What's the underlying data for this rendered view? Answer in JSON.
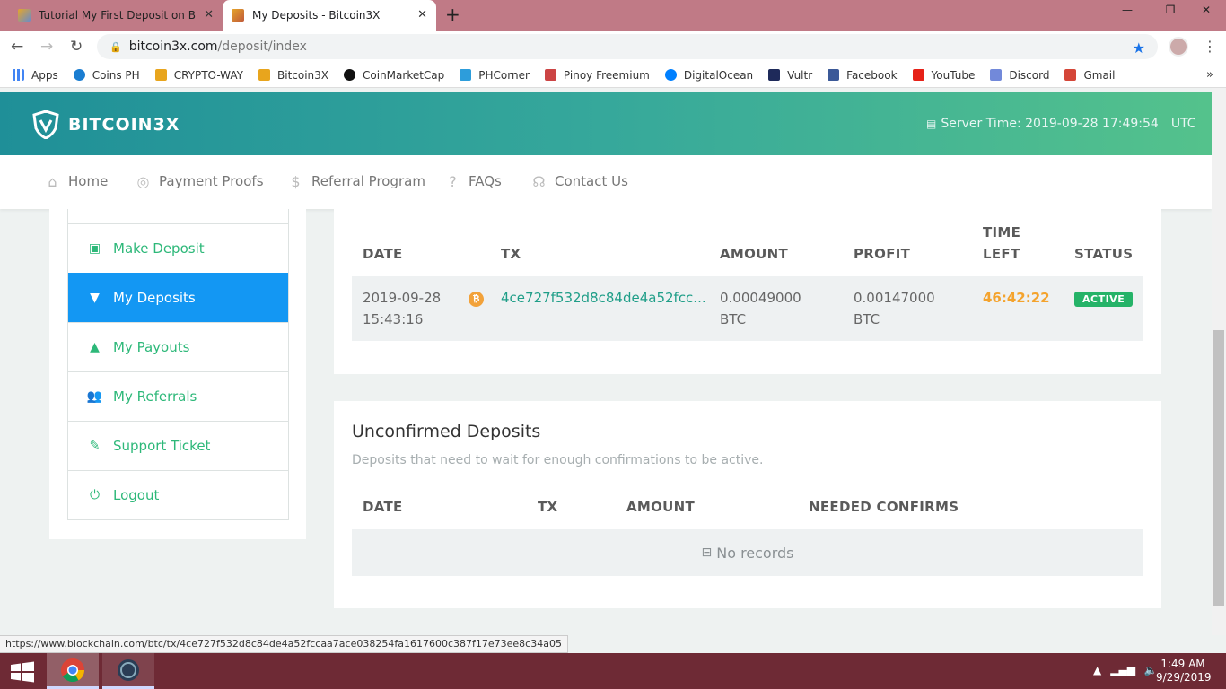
{
  "browser": {
    "tabs": [
      {
        "title": "Tutorial My First Deposit on Bitco",
        "active": false
      },
      {
        "title": "My Deposits - Bitcoin3X",
        "active": true
      }
    ],
    "new_tab_icon": "plus-icon",
    "url_host": "bitcoin3x.com",
    "url_path": "/deposit/index",
    "bookmarks": [
      {
        "label": "Apps",
        "icon": "apps-grid-icon",
        "color": "#4285f4"
      },
      {
        "label": "Coins PH",
        "icon": "coins-ph-icon",
        "color": "#1a7dd1"
      },
      {
        "label": "CRYPTO-WAY",
        "icon": "shield-icon",
        "color": "#e8a51d"
      },
      {
        "label": "Bitcoin3X",
        "icon": "shield-icon",
        "color": "#e8a51d"
      },
      {
        "label": "CoinMarketCap",
        "icon": "coinmarketcap-icon",
        "color": "#111111"
      },
      {
        "label": "PHCorner",
        "icon": "cube-icon",
        "color": "#2d9ddb"
      },
      {
        "label": "Pinoy Freemium",
        "icon": "flag-icon",
        "color": "#c44"
      },
      {
        "label": "DigitalOcean",
        "icon": "digitalocean-icon",
        "color": "#0080ff"
      },
      {
        "label": "Vultr",
        "icon": "vultr-icon",
        "color": "#1e2a5a"
      },
      {
        "label": "Facebook",
        "icon": "facebook-icon",
        "color": "#3b5998"
      },
      {
        "label": "YouTube",
        "icon": "youtube-icon",
        "color": "#e62117"
      },
      {
        "label": "Discord",
        "icon": "discord-icon",
        "color": "#7289da"
      },
      {
        "label": "Gmail",
        "icon": "gmail-icon",
        "color": "#d44638"
      }
    ],
    "more_bookmarks": "»",
    "status_url": "https://www.blockchain.com/btc/tx/4ce727f532d8c84de4a52fccaa7ace038254fa1617600c387f17e73ee8c34a05"
  },
  "site": {
    "logo_text": "BITCOIN3X",
    "server_time_label": "Server Time: 2019-09-28 17:49:54",
    "server_time_zone": "UTC",
    "nav": [
      {
        "label": "Home",
        "icon": "home-icon"
      },
      {
        "label": "Payment Proofs",
        "icon": "target-icon"
      },
      {
        "label": "Referral Program",
        "icon": "dollar-circle-icon"
      },
      {
        "label": "FAQs",
        "icon": "question-icon"
      },
      {
        "label": "Contact Us",
        "icon": "headset-icon"
      }
    ],
    "sidebar": [
      {
        "label": "Make Deposit",
        "icon": "add-card-icon",
        "active": false
      },
      {
        "label": "My Deposits",
        "icon": "deposit-box-icon",
        "active": true
      },
      {
        "label": "My Payouts",
        "icon": "payout-box-icon",
        "active": false
      },
      {
        "label": "My Referrals",
        "icon": "users-icon",
        "active": false
      },
      {
        "label": "Support Ticket",
        "icon": "ticket-icon",
        "active": false
      },
      {
        "label": "Logout",
        "icon": "power-icon",
        "active": false
      }
    ],
    "deposits": {
      "headers": {
        "date": "DATE",
        "tx": "TX",
        "amount": "AMOUNT",
        "profit": "PROFIT",
        "time_left_1": "TIME",
        "time_left_2": "LEFT",
        "status": "STATUS"
      },
      "rows": [
        {
          "date": "2019-09-28",
          "time": "15:43:16",
          "coin_icon": "bitcoin-icon",
          "tx": "4ce727f532d8c84de4a52fcc...",
          "amount": "0.00049000",
          "amount_unit": "BTC",
          "profit": "0.00147000",
          "profit_unit": "BTC",
          "time_left": "46:42:22",
          "status": "ACTIVE"
        }
      ]
    },
    "unconfirmed": {
      "title": "Unconfirmed Deposits",
      "subtitle": "Deposits that need to wait for enough confirmations to be active.",
      "headers": {
        "date": "DATE",
        "tx": "TX",
        "amount": "AMOUNT",
        "confirms": "NEEDED CONFIRMS"
      },
      "empty_text": "No records",
      "empty_icon": "inbox-icon"
    }
  },
  "taskbar": {
    "time": "1:49 AM",
    "date": "9/29/2019",
    "apps": [
      "chrome-icon",
      "app-icon"
    ]
  },
  "colors": {
    "accent_blue": "#1397f3",
    "accent_green": "#2db879",
    "header_gradient_start": "#1f8f98",
    "header_gradient_end": "#54c28c",
    "time_left": "#f4a32d",
    "active_badge": "#25b368"
  }
}
